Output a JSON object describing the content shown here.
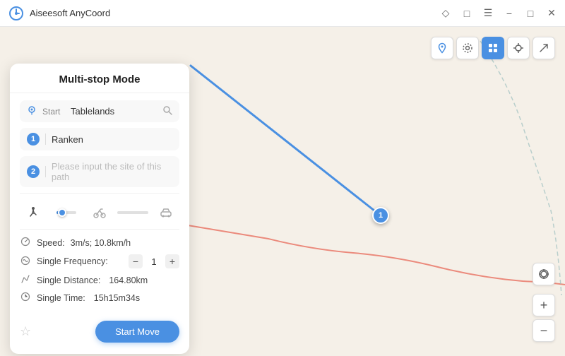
{
  "app": {
    "title": "Aiseesoft AnyCoord",
    "logo_color": "#4a90e2"
  },
  "titlebar": {
    "controls": [
      "diamond-icon",
      "square-icon",
      "menu-icon",
      "minimize-icon",
      "maximize-icon",
      "close-icon"
    ]
  },
  "panel": {
    "title": "Multi-stop Mode",
    "start_label": "Start",
    "start_value": "Tablelands",
    "waypoint1_num": "1",
    "waypoint1_value": "Ranken",
    "waypoint2_num": "2",
    "waypoint2_placeholder": "Please input the site of this path",
    "speed_label": "Speed:",
    "speed_value": "3m/s; 10.8km/h",
    "frequency_label": "Single Frequency: ",
    "frequency_value": "1",
    "distance_label": "Single Distance:",
    "distance_value": "164.80km",
    "time_label": "Single Time:",
    "time_value": "15h15m34s",
    "start_move_label": "Start Move"
  },
  "toolbar": {
    "btn1": "📍",
    "btn2": "⚙",
    "btn3_active": "grid",
    "btn4": "⊕",
    "btn5": "↗"
  },
  "map": {
    "zoom_in": "+",
    "zoom_out": "−",
    "locate": "◎"
  }
}
